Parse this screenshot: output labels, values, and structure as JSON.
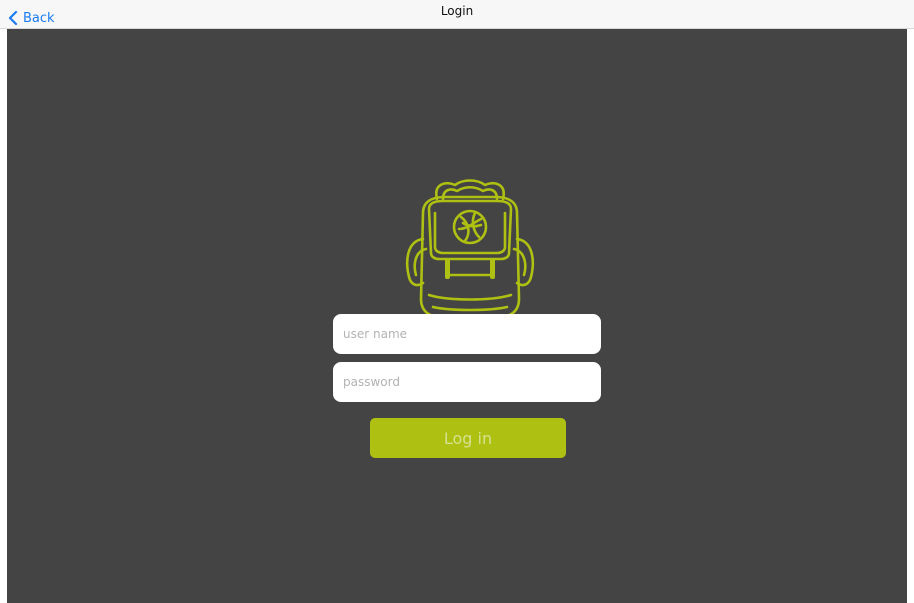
{
  "nav": {
    "back_label": "Back",
    "title": "Login"
  },
  "logo": {
    "icon": "backpack-logo-icon"
  },
  "form": {
    "username_placeholder": "user name",
    "username_value": "",
    "password_placeholder": "password",
    "password_value": "",
    "login_label": "Log in"
  },
  "colors": {
    "nav_background": "#f7f7f7",
    "back_link": "#1a7cf2",
    "content_background": "#444444",
    "accent": "#aec011",
    "button_text": "#d6e18e",
    "field_background": "#ffffff",
    "placeholder": "#b2b2b2"
  }
}
